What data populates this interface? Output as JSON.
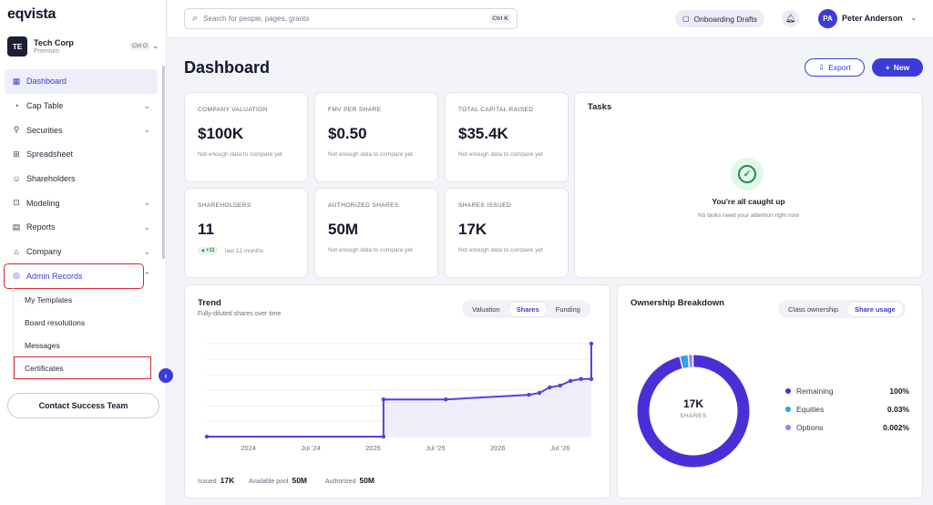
{
  "brand": {
    "logo": "eqvista"
  },
  "company": {
    "initials": "TE",
    "name": "Tech Corp",
    "plan": "Premium",
    "shortcut": "Ctrl O"
  },
  "sidebar": {
    "items": [
      {
        "label": "Dashboard",
        "icon": "dashboard-icon",
        "active": true
      },
      {
        "label": "Cap Table",
        "icon": "pie-chart-icon",
        "chevron": "down"
      },
      {
        "label": "Securities",
        "icon": "securities-icon",
        "chevron": "down"
      },
      {
        "label": "Spreadsheet",
        "icon": "grid-icon"
      },
      {
        "label": "Shareholders",
        "icon": "people-icon"
      },
      {
        "label": "Modeling",
        "icon": "modeling-icon",
        "chevron": "down"
      },
      {
        "label": "Reports",
        "icon": "reports-icon",
        "chevron": "down"
      },
      {
        "label": "Company",
        "icon": "company-icon",
        "chevron": "down"
      },
      {
        "label": "Admin Records",
        "icon": "admin-records-icon",
        "chevron": "up",
        "highlighted": true
      }
    ],
    "sub_items": [
      {
        "label": "My Templates"
      },
      {
        "label": "Board resolutions"
      },
      {
        "label": "Messages"
      },
      {
        "label": "Certificates",
        "highlighted": true
      }
    ],
    "contact_button": "Contact Success Team"
  },
  "topbar": {
    "search_placeholder": "Search for people, pages, grants",
    "search_shortcut": "Ctrl K",
    "drafts_label": "Onboarding Drafts",
    "user_initials": "PA",
    "user_name": "Peter Anderson"
  },
  "page": {
    "title": "Dashboard",
    "export_label": "Export",
    "new_label": "New"
  },
  "metrics": [
    {
      "label": "Company valuation",
      "value": "$100K",
      "note": "Not enough data to compare yet"
    },
    {
      "label": "FMV per share",
      "value": "$0.50",
      "note": "Not enough data to compare yet"
    },
    {
      "label": "Total capital raised",
      "value": "$35.4K",
      "note": "Not enough data to compare yet"
    },
    {
      "label": "Shareholders",
      "value": "11",
      "chip": "▲+11",
      "chip_note": "last 12 months"
    },
    {
      "label": "Authorized shares",
      "value": "50M",
      "note": "Not enough data to compare yet"
    },
    {
      "label": "Shares issued",
      "value": "17K",
      "note": "Not enough data to compare yet"
    }
  ],
  "tasks": {
    "title": "Tasks",
    "heading": "You're all caught up",
    "subtext": "No tasks need your attention right now"
  },
  "trend": {
    "title": "Trend",
    "subtitle": "Fully-diluted shares over time",
    "tabs": [
      "Valuation",
      "Shares",
      "Funding"
    ],
    "active_tab": "Shares",
    "footer": [
      {
        "label": "Issued",
        "value": "17K"
      },
      {
        "label": "Available pool",
        "value": "50M"
      },
      {
        "label": "Authorized",
        "value": "50M"
      }
    ]
  },
  "ownership": {
    "title": "Ownership Breakdown",
    "tabs": [
      "Class ownership",
      "Share usage"
    ],
    "active_tab": "Share usage",
    "center_value": "17K",
    "center_label": "SHARES",
    "legend": [
      {
        "name": "Remaining",
        "value": "100%",
        "color": "#4b2fd6"
      },
      {
        "name": "Equities",
        "value": "0.03%",
        "color": "#2aa3f0"
      },
      {
        "name": "Options",
        "value": "0.002%",
        "color": "#9b84ee"
      }
    ]
  },
  "chart_data": {
    "type": "line",
    "x_tick_labels": [
      "2024",
      "Jul '24",
      "2025",
      "Jul '25",
      "2026",
      "Jul '26"
    ],
    "series": [
      {
        "points": [
          {
            "x": "2023-09",
            "y": 0
          },
          {
            "x": "2025-02",
            "y": 0
          },
          {
            "x": "2025-02",
            "y": 0.4
          },
          {
            "x": "2025-08",
            "y": 0.4
          },
          {
            "x": "2026-04",
            "y": 0.45
          },
          {
            "x": "2026-05",
            "y": 0.47
          },
          {
            "x": "2026-06",
            "y": 0.53
          },
          {
            "x": "2026-07",
            "y": 0.55
          },
          {
            "x": "2026-08",
            "y": 0.6
          },
          {
            "x": "2026-09",
            "y": 0.62
          },
          {
            "x": "2026-10",
            "y": 0.62
          },
          {
            "x": "2026-10",
            "y": 1
          }
        ]
      }
    ],
    "fill": true,
    "color": "#5b3ee0"
  }
}
